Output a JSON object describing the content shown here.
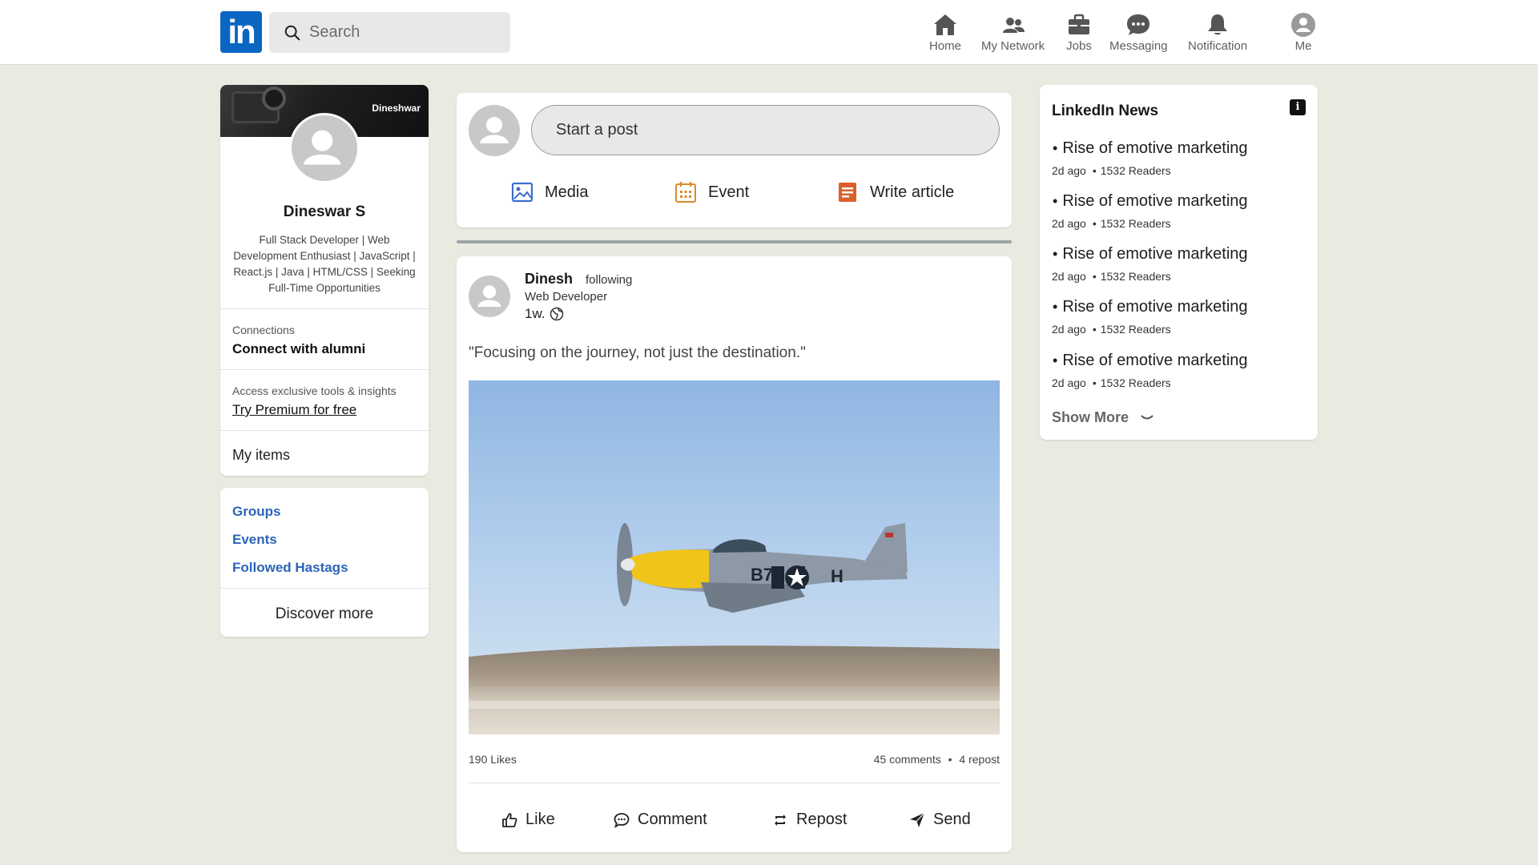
{
  "nav": {
    "logo_text": "in",
    "search_placeholder": "Search",
    "items": [
      {
        "label": "Home",
        "icon": "home-icon"
      },
      {
        "label": "My Network",
        "icon": "network-icon"
      },
      {
        "label": "Jobs",
        "icon": "briefcase-icon"
      },
      {
        "label": "Messaging",
        "icon": "chat-icon"
      },
      {
        "label": "Notification",
        "icon": "bell-icon"
      },
      {
        "label": "Me",
        "icon": "avatar-icon"
      }
    ]
  },
  "profile": {
    "cover_brand": "Dineshwar",
    "name": "Dineswar S",
    "headline": "Full Stack Developer | Web Development Enthusiast | JavaScript | React.js | Java | HTML/CSS | Seeking Full-Time Opportunities",
    "connections_label": "Connections",
    "connections_action": "Connect with alumni",
    "premium_label": "Access exclusive tools & insights",
    "premium_action": "Try Premium for free",
    "my_items": "My items"
  },
  "links": {
    "groups": "Groups",
    "events": "Events",
    "hashtags": "Followed Hastags",
    "discover": "Discover more"
  },
  "composer": {
    "placeholder": "Start a post",
    "media": "Media",
    "event": "Event",
    "article": "Write article"
  },
  "post": {
    "author": "Dinesh",
    "follow_status": "following",
    "role": "Web Developer",
    "time": "1w.",
    "text": "\"Focusing on the journey, not just the destination.\"",
    "likes": "190 Likes",
    "comments": "45 comments",
    "reposts": "4 repost",
    "actions": {
      "like": "Like",
      "comment": "Comment",
      "repost": "Repost",
      "send": "Send"
    }
  },
  "news": {
    "title": "LinkedIn News",
    "items": [
      {
        "headline": "Rise of emotive marketing",
        "age": "2d ago",
        "readers": "1532 Readers"
      },
      {
        "headline": "Rise of emotive marketing",
        "age": "2d ago",
        "readers": "1532 Readers"
      },
      {
        "headline": "Rise of emotive marketing",
        "age": "2d ago",
        "readers": "1532 Readers"
      },
      {
        "headline": "Rise of emotive marketing",
        "age": "2d ago",
        "readers": "1532 Readers"
      },
      {
        "headline": "Rise of emotive marketing",
        "age": "2d ago",
        "readers": "1532 Readers"
      }
    ],
    "show_more": "Show More"
  },
  "colors": {
    "brand_blue": "#0a66c2",
    "link_blue": "#2c64b8",
    "page_bg": "#e9ebe0",
    "media_icon": "#3a6ecf",
    "event_icon": "#d98a2b",
    "article_icon": "#d9602b"
  }
}
